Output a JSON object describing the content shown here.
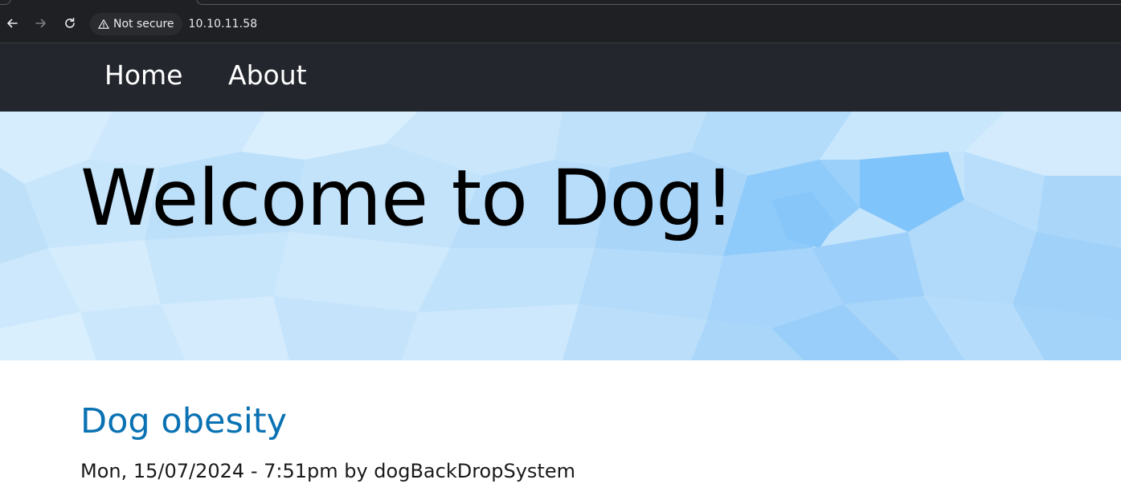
{
  "browser": {
    "security_label": "Not secure",
    "url": "10.10.11.58",
    "icons": {
      "back": "arrow-left-icon",
      "forward": "arrow-right-icon",
      "reload": "reload-icon",
      "warning": "warning-triangle-icon"
    }
  },
  "nav": {
    "items": [
      {
        "label": "Home"
      },
      {
        "label": "About"
      }
    ]
  },
  "hero": {
    "title": "Welcome to Dog!"
  },
  "article": {
    "title": "Dog obesity",
    "meta": "Mon, 15/07/2024 - 7:51pm by dogBackDropSystem"
  },
  "colors": {
    "chrome_bg": "#1f2023",
    "nav_bg": "#23262d",
    "hero_bg": "#c4e4fb",
    "link": "#0a72b3"
  }
}
